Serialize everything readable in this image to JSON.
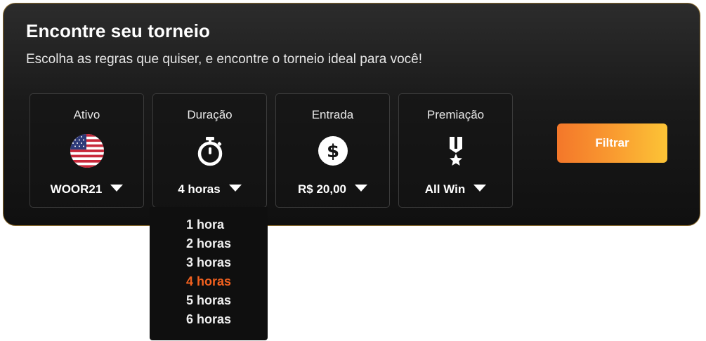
{
  "header": {
    "title": "Encontre seu torneio",
    "subtitle": "Escolha as regras que quiser, e encontre o torneio ideal para você!"
  },
  "filters": [
    {
      "label": "Ativo",
      "icon": "us-flag-icon",
      "value": "WOOR21"
    },
    {
      "label": "Duração",
      "icon": "stopwatch-icon",
      "value": "4 horas"
    },
    {
      "label": "Entrada",
      "icon": "dollar-coin-icon",
      "value": "R$ 20,00"
    },
    {
      "label": "Premiação",
      "icon": "medal-icon",
      "value": "All Win"
    }
  ],
  "filter_button": {
    "label": "Filtrar"
  },
  "duration_dropdown": {
    "options": [
      "1 hora",
      "2 horas",
      "3 horas",
      "4 horas",
      "5 horas",
      "6 horas"
    ],
    "selected": "4 horas"
  },
  "colors": {
    "accent": "#f3611f",
    "button_gradient_start": "#f4772a",
    "button_gradient_end": "#fcc436",
    "panel_border": "#8a6a2c"
  }
}
